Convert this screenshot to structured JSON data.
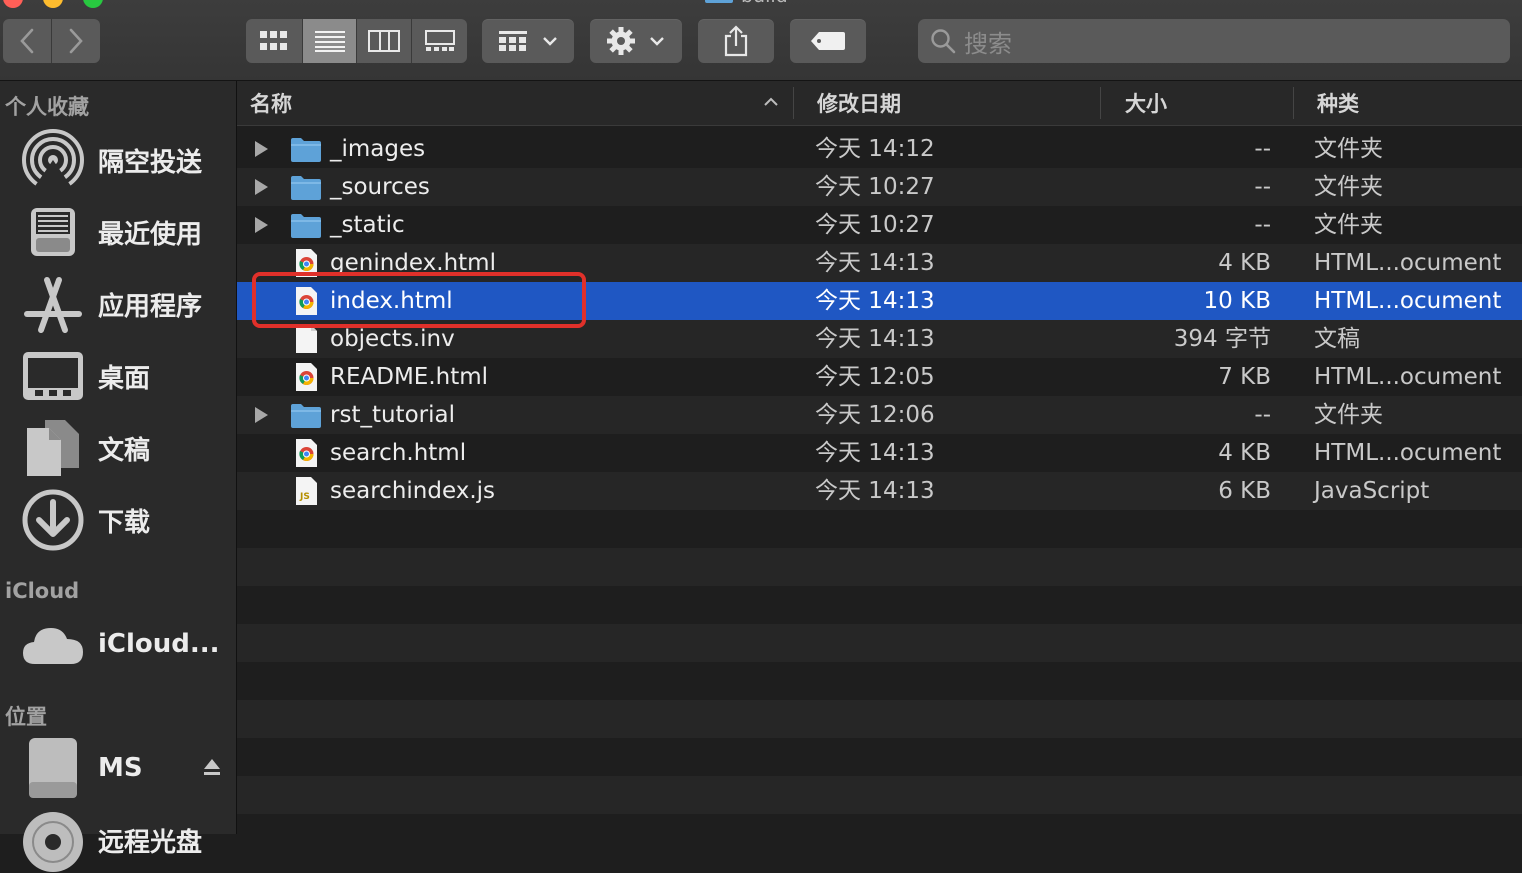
{
  "window": {
    "title": "build"
  },
  "toolbar": {
    "search": {
      "placeholder": "搜索"
    }
  },
  "sidebar": {
    "favorites_header": "个人收藏",
    "favorites": [
      {
        "label": "隔空投送",
        "icon": "airdrop-icon"
      },
      {
        "label": "最近使用",
        "icon": "recents-icon"
      },
      {
        "label": "应用程序",
        "icon": "applications-icon"
      },
      {
        "label": "桌面",
        "icon": "desktop-icon"
      },
      {
        "label": "文稿",
        "icon": "documents-icon"
      },
      {
        "label": "下载",
        "icon": "downloads-icon"
      }
    ],
    "icloud_header": "iCloud",
    "icloud": [
      {
        "label": "iCloud...",
        "icon": "cloud-icon"
      }
    ],
    "locations_header": "位置",
    "locations": [
      {
        "label": "MS",
        "icon": "disk-icon",
        "ejectable": true
      },
      {
        "label": "远程光盘",
        "icon": "remote-disc-icon"
      }
    ]
  },
  "columns": {
    "name": "名称",
    "modified": "修改日期",
    "size": "大小",
    "kind": "种类"
  },
  "files": [
    {
      "name": "_images",
      "date": "今天 14:12",
      "size": "--",
      "kind": "文件夹",
      "type": "folder"
    },
    {
      "name": "_sources",
      "date": "今天 10:27",
      "size": "--",
      "kind": "文件夹",
      "type": "folder"
    },
    {
      "name": "_static",
      "date": "今天 10:27",
      "size": "--",
      "kind": "文件夹",
      "type": "folder"
    },
    {
      "name": "genindex.html",
      "date": "今天 14:13",
      "size": "4 KB",
      "kind": "HTML...ocument",
      "type": "html"
    },
    {
      "name": "index.html",
      "date": "今天 14:13",
      "size": "10 KB",
      "kind": "HTML...ocument",
      "type": "html",
      "selected": true
    },
    {
      "name": "objects.inv",
      "date": "今天 14:13",
      "size": "394 字节",
      "kind": "文稿",
      "type": "doc"
    },
    {
      "name": "README.html",
      "date": "今天 12:05",
      "size": "7 KB",
      "kind": "HTML...ocument",
      "type": "html"
    },
    {
      "name": "rst_tutorial",
      "date": "今天 12:06",
      "size": "--",
      "kind": "文件夹",
      "type": "folder"
    },
    {
      "name": "search.html",
      "date": "今天 14:13",
      "size": "4 KB",
      "kind": "HTML...ocument",
      "type": "html"
    },
    {
      "name": "searchindex.js",
      "date": "今天 14:13",
      "size": "6 KB",
      "kind": "JavaScript",
      "type": "js"
    }
  ],
  "colors": {
    "selection": "#1f57c3",
    "annotation": "#e0302a",
    "folder": "#5ea2d8"
  }
}
